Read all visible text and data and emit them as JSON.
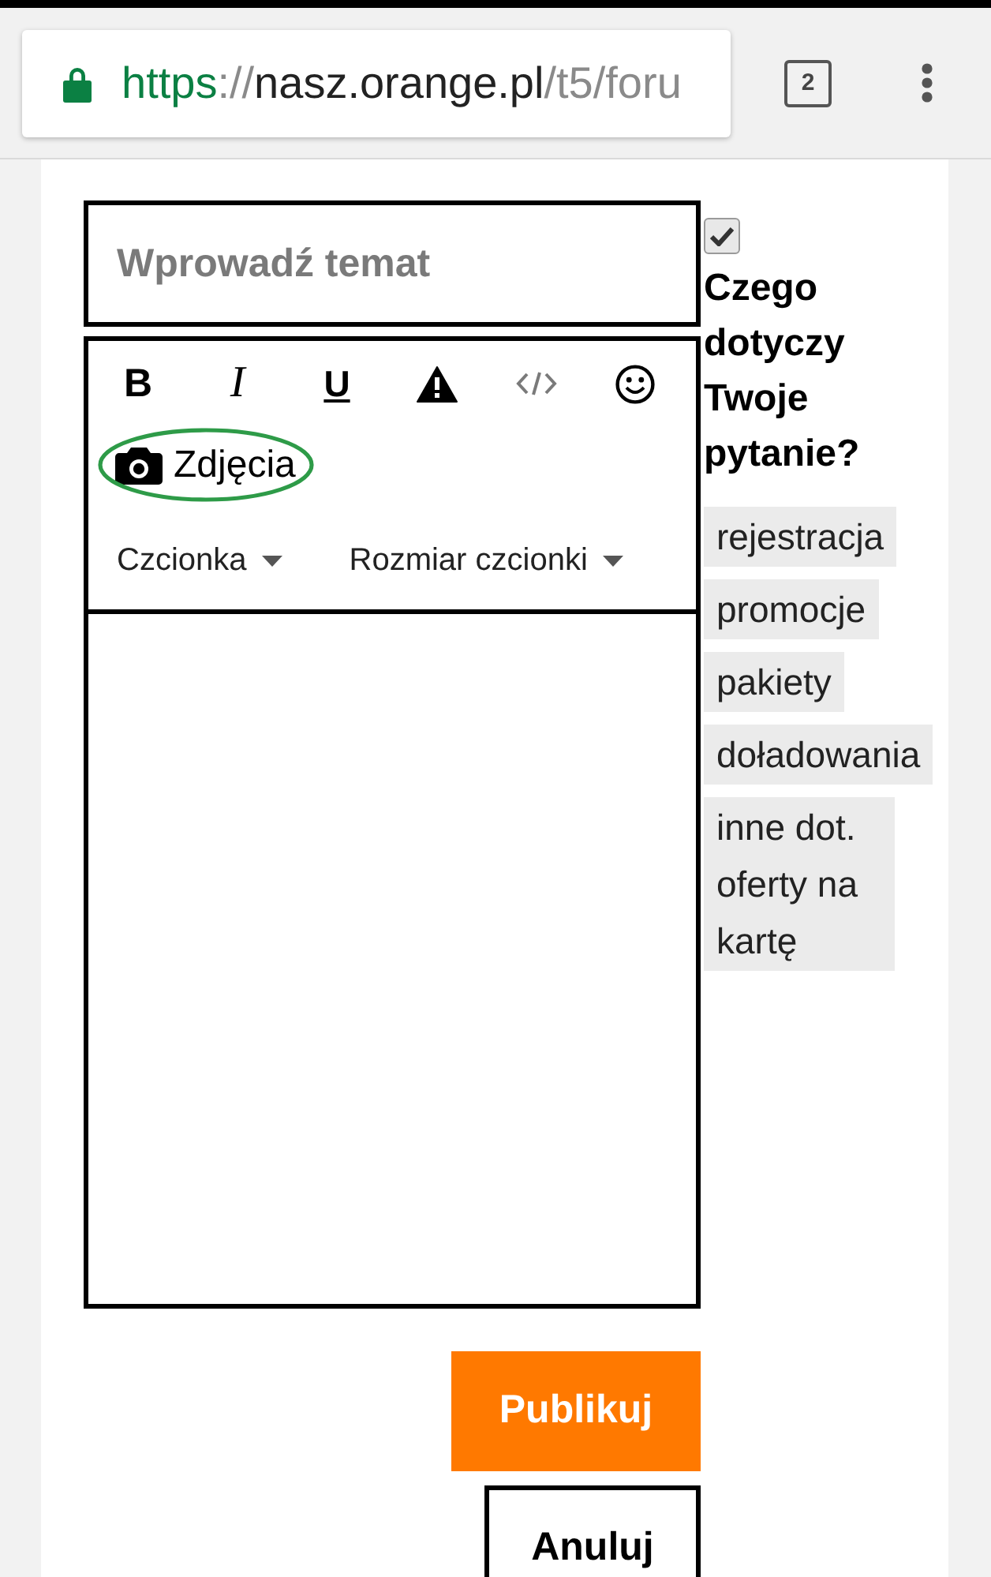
{
  "browser": {
    "url_parts": [
      {
        "kind": "scheme",
        "text": "https"
      },
      {
        "kind": "separator",
        "text": "://"
      },
      {
        "kind": "host",
        "text": "nasz.orange.pl"
      },
      {
        "kind": "path",
        "text": "/t5/foru"
      }
    ],
    "tab_count": "2"
  },
  "subject": {
    "placeholder": "Wprowadź temat"
  },
  "toolbar": {
    "buttons": [
      {
        "kind": "bold",
        "label": "B"
      },
      {
        "kind": "italic",
        "label": "I"
      },
      {
        "kind": "underline",
        "label": "U"
      },
      {
        "kind": "warning"
      },
      {
        "kind": "code"
      },
      {
        "kind": "emoji"
      }
    ],
    "photos": {
      "label": "Zdjęcia",
      "circled": true
    },
    "dropdowns": [
      {
        "label": "Czcionka"
      },
      {
        "label": "Rozmiar czcionki"
      }
    ]
  },
  "sidebar": {
    "checkbox": {
      "checked": true
    },
    "heading": "Czego dotyczy Twoje pytanie?",
    "tags": [
      {
        "label": "rejestracja"
      },
      {
        "label": "promocje"
      },
      {
        "label": "pakiety"
      },
      {
        "label": "doładowania"
      },
      {
        "label": "inne dot. oferty na kartę"
      }
    ]
  },
  "buttons": [
    {
      "kind": "primary",
      "label": "Publikuj"
    },
    {
      "kind": "secondary",
      "label": "Anuluj"
    }
  ]
}
